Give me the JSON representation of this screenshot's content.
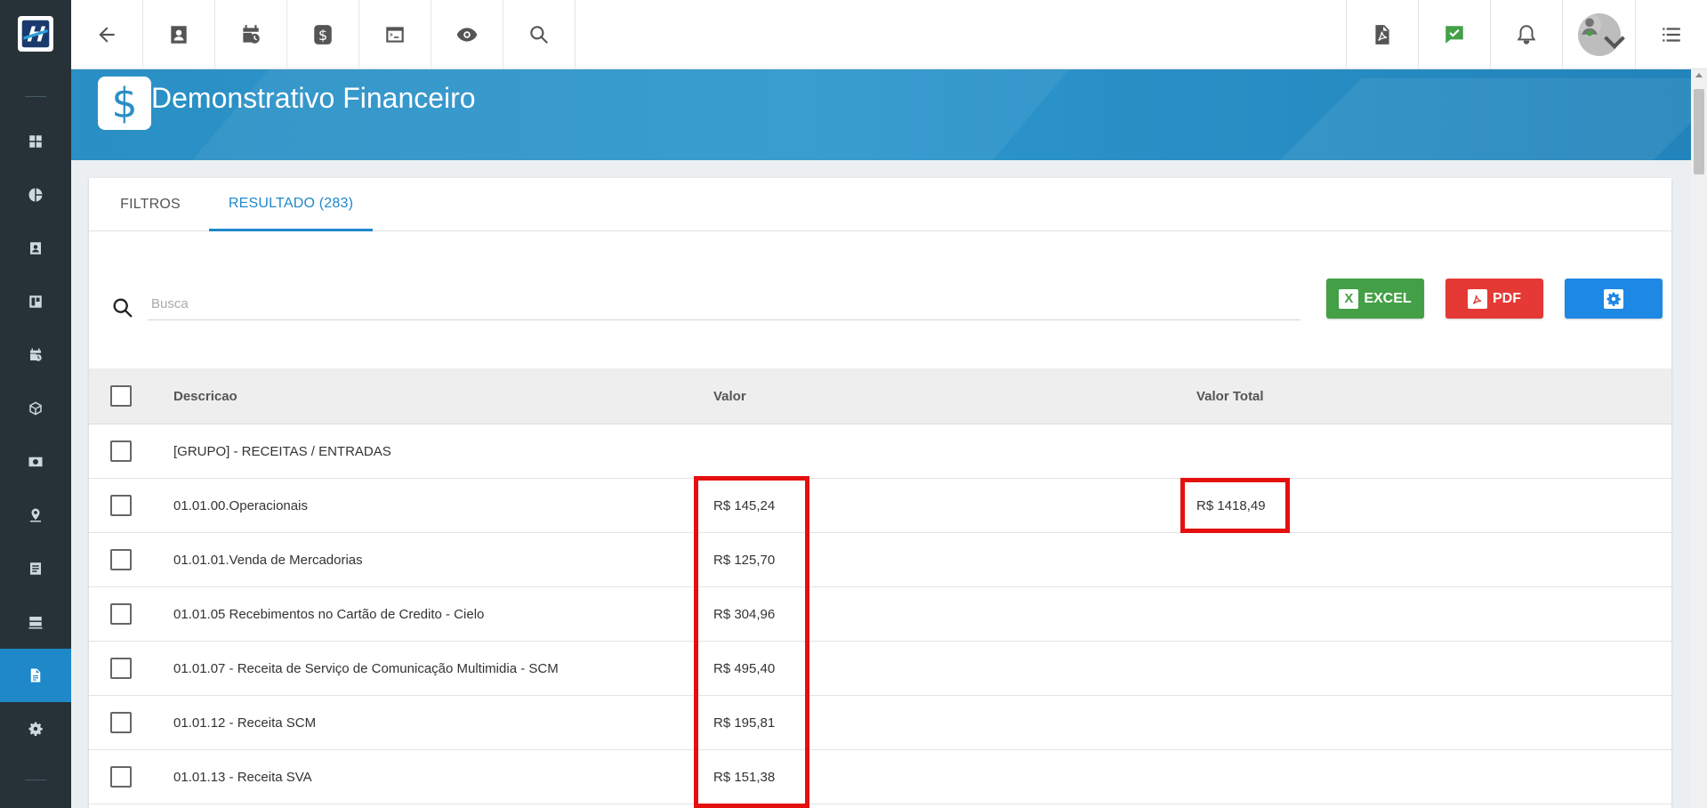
{
  "page": {
    "title": "Demonstrativo Financeiro",
    "icon": "dollar-icon"
  },
  "sidebar": {
    "items": [
      {
        "icon": "dashboard-icon",
        "active": false
      },
      {
        "icon": "pie-chart-icon",
        "active": false
      },
      {
        "icon": "contact-card-icon",
        "active": false
      },
      {
        "icon": "board-icon",
        "active": false
      },
      {
        "icon": "calendar-clock-icon",
        "active": false
      },
      {
        "icon": "box-icon",
        "active": false
      },
      {
        "icon": "money-icon",
        "active": false
      },
      {
        "icon": "map-pin-icon",
        "active": false
      },
      {
        "icon": "list-document-icon",
        "active": false
      },
      {
        "icon": "server-icon",
        "active": false
      },
      {
        "icon": "report-document-icon",
        "active": true
      },
      {
        "icon": "gear-icon",
        "active": false
      }
    ]
  },
  "topbar": {
    "left_buttons": [
      "back-arrow-icon",
      "contact-card-icon",
      "calendar-clock-icon",
      "dollar-icon",
      "terminal-icon",
      "eye-icon",
      "search-icon"
    ],
    "right_buttons": [
      "pdf-file-icon",
      "chat-check-icon",
      "bell-icon",
      "user-avatar",
      "menu-list-icon"
    ]
  },
  "tabs": [
    {
      "label": "FILTROS",
      "active": false
    },
    {
      "label": "RESULTADO (283)",
      "active": true
    }
  ],
  "search": {
    "placeholder": "Busca",
    "value": ""
  },
  "actions": {
    "excel_label": "EXCEL",
    "excel_badge": "X",
    "pdf_label": "PDF"
  },
  "table": {
    "headers": {
      "descricao": "Descricao",
      "valor": "Valor",
      "valor_total": "Valor Total"
    },
    "rows": [
      {
        "descricao": "[GRUPO] - RECEITAS / ENTRADAS",
        "valor": "",
        "valor_total": ""
      },
      {
        "descricao": "01.01.00.Operacionais",
        "valor": "R$ 145,24",
        "valor_total": "R$ 1418,49"
      },
      {
        "descricao": "01.01.01.Venda de Mercadorias",
        "valor": "R$ 125,70",
        "valor_total": ""
      },
      {
        "descricao": "01.01.05 Recebimentos no Cartão de Credito - Cielo",
        "valor": "R$ 304,96",
        "valor_total": ""
      },
      {
        "descricao": "01.01.07 - Receita de Serviço de Comunicação Multimidia - SCM",
        "valor": "R$ 495,40",
        "valor_total": ""
      },
      {
        "descricao": "01.01.12 - Receita SCM",
        "valor": "R$ 195,81",
        "valor_total": ""
      },
      {
        "descricao": "01.01.13 - Receita SVA",
        "valor": "R$ 151,38",
        "valor_total": ""
      }
    ]
  },
  "colors": {
    "accent": "#1e88c9",
    "sidebar": "#263238",
    "excel": "#43a047",
    "pdf": "#e53935",
    "settings": "#1e88e5",
    "highlight": "#e41010"
  }
}
